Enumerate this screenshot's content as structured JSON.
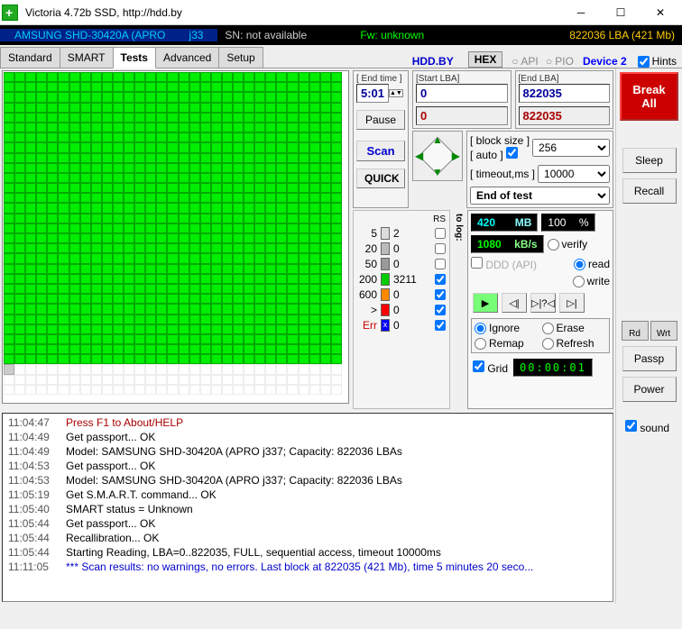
{
  "window": {
    "title": "Victoria 4.72b SSD, http://hdd.by"
  },
  "infobar": {
    "drive": "AMSUNG SHD-30420A (APRO",
    "drive_suffix": "j33",
    "sn": "SN: not available",
    "fw": "Fw: unknown",
    "lba": "822036 LBA (421 Mb)"
  },
  "tabs": {
    "standard": "Standard",
    "smart": "SMART",
    "tests": "Tests",
    "advanced": "Advanced",
    "setup": "Setup",
    "hddby": "HDD.BY",
    "hex": "HEX",
    "api": "API",
    "pio": "PIO",
    "device": "Device 2",
    "hints": "Hints"
  },
  "scan": {
    "endtime_lbl": "[ End time ]",
    "endtime_val": "5:01",
    "startlba_lbl": "[Start LBA]",
    "startlba_val": "0",
    "startlba_ro": "0",
    "endlba_lbl": "[End LBA]",
    "endlba_val": "822035",
    "endlba_ro": "822035",
    "pause": "Pause",
    "scan": "Scan",
    "quick": "QUICK",
    "blocksize_lbl": "[ block size ]",
    "auto_lbl": "[ auto ]",
    "blocksize_val": "256",
    "timeout_lbl": "[ timeout,ms ]",
    "timeout_val": "10000",
    "endtest": "End of test"
  },
  "legend": {
    "rs": "RS",
    "tolog": "to log:",
    "l5": "5",
    "v5": "2",
    "l20": "20",
    "v20": "0",
    "l50": "50",
    "v50": "0",
    "l200": "200",
    "v200": "3211",
    "l600": "600",
    "v600": "0",
    "lgt": ">",
    "vgt": "0",
    "lerr": "Err",
    "verr": "0"
  },
  "stats": {
    "mb_val": "420",
    "mb_unit": "MB",
    "pct": "100",
    "pct_unit": "%",
    "kbs_val": "1080",
    "kbs_unit": "kB/s",
    "ddd": "DDD (API)",
    "verify": "verify",
    "read": "read",
    "write": "write",
    "ignore": "Ignore",
    "erase": "Erase",
    "remap": "Remap",
    "refresh": "Refresh",
    "grid": "Grid",
    "counter": "00:00:01"
  },
  "sidebar": {
    "break": "Break All",
    "sleep": "Sleep",
    "recall": "Recall",
    "rd": "Rd",
    "wrt": "Wrt",
    "passp": "Passp",
    "power": "Power",
    "sound": "sound"
  },
  "log": [
    {
      "t": "11:04:47",
      "m": "Press F1 to About/HELP",
      "c": "red"
    },
    {
      "t": "11:04:49",
      "m": "Get passport... OK",
      "c": ""
    },
    {
      "t": "11:04:49",
      "m": "Model: SAMSUNG SHD-30420A (APRO    j337; Capacity: 822036 LBAs",
      "c": ""
    },
    {
      "t": "11:04:53",
      "m": "Get passport... OK",
      "c": ""
    },
    {
      "t": "11:04:53",
      "m": "Model: SAMSUNG SHD-30420A (APRO    j337; Capacity: 822036 LBAs",
      "c": ""
    },
    {
      "t": "11:05:19",
      "m": "Get S.M.A.R.T. command... OK",
      "c": ""
    },
    {
      "t": "11:05:40",
      "m": "SMART status = Unknown",
      "c": ""
    },
    {
      "t": "11:05:44",
      "m": "Get passport... OK",
      "c": ""
    },
    {
      "t": "11:05:44",
      "m": "Recallibration... OK",
      "c": ""
    },
    {
      "t": "11:05:44",
      "m": "Starting Reading, LBA=0..822035, FULL, sequential access, timeout 10000ms",
      "c": ""
    },
    {
      "t": "11:11:05",
      "m": "*** Scan results: no warnings, no errors. Last block at 822035 (421 Mb), time 5 minutes 20 seco...",
      "c": "blue"
    }
  ],
  "surface": {
    "total": 992,
    "filled": 899,
    "partial": 1
  }
}
